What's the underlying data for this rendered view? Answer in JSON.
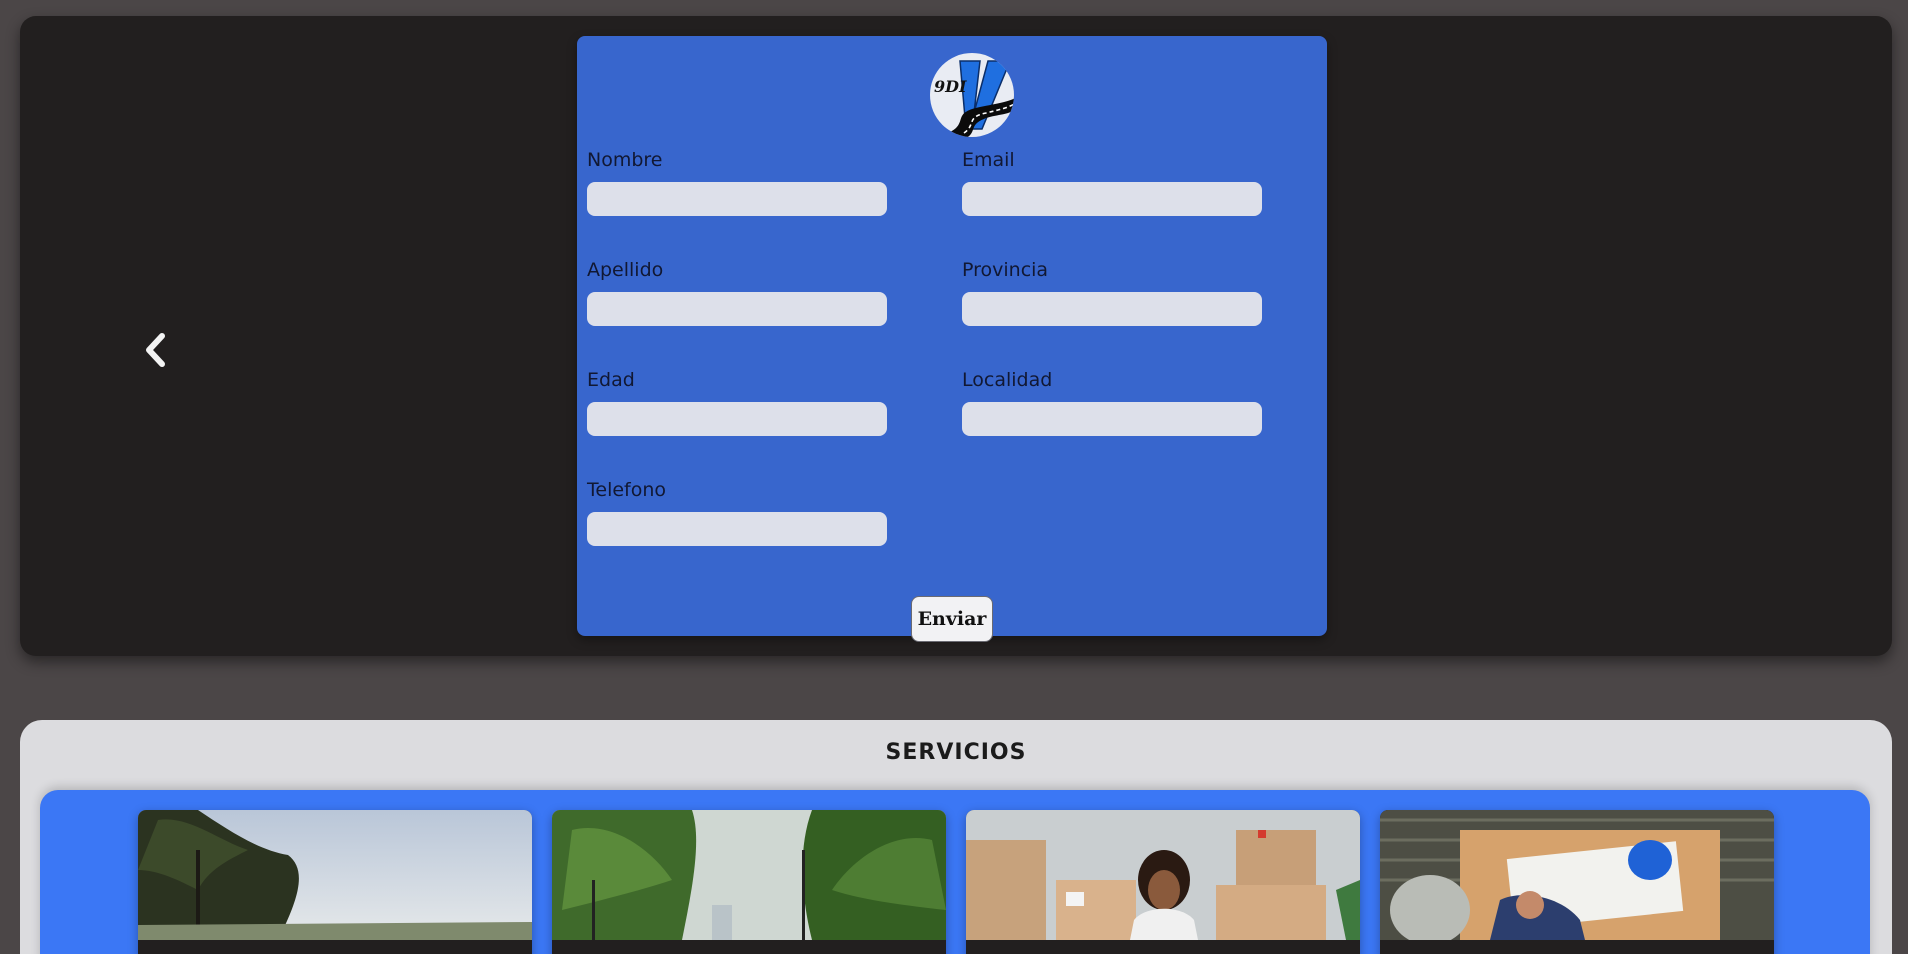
{
  "form": {
    "logo_text": "9DI",
    "fields": [
      {
        "label": "Nombre",
        "value": ""
      },
      {
        "label": "Email",
        "value": ""
      },
      {
        "label": "Apellido",
        "value": ""
      },
      {
        "label": "Provincia",
        "value": ""
      },
      {
        "label": "Edad",
        "value": ""
      },
      {
        "label": "Localidad",
        "value": ""
      },
      {
        "label": "Telefono",
        "value": ""
      }
    ],
    "submit_label": "Enviar"
  },
  "carousel": {
    "prev_icon": "chevron-left-icon"
  },
  "services": {
    "title": "SERVICIOS",
    "cards": [
      {
        "image": "trees-sky-photo"
      },
      {
        "image": "road-trees-photo"
      },
      {
        "image": "woman-moving-boxes-photo"
      },
      {
        "image": "architect-desk-photo"
      }
    ]
  },
  "colors": {
    "page_bg": "#4b4647",
    "hero_bg": "#221f1f",
    "form_bg": "#3866cd",
    "input_bg": "#dde0ea",
    "services_bg": "#dcdcdf",
    "services_panel_bg": "#3b77f5"
  }
}
